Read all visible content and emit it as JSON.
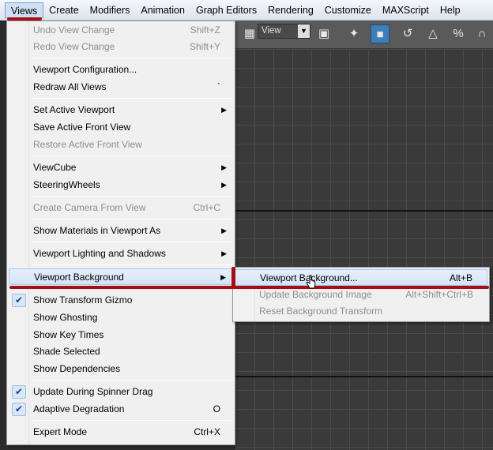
{
  "menubar": {
    "items": [
      "Views",
      "Create",
      "Modifiers",
      "Animation",
      "Graph Editors",
      "Rendering",
      "Customize",
      "MAXScript",
      "Help"
    ]
  },
  "toolbar": {
    "view_select": "View",
    "icons": [
      "viewport-split-icon",
      "walkthrough-icon",
      "box-icon",
      "snap-3d-icon",
      "angle-snap-icon",
      "percent-snap-icon",
      "spinner-snap-icon"
    ]
  },
  "views_menu": {
    "items": [
      {
        "label": "Undo View Change",
        "shortcut": "Shift+Z",
        "disabled": true
      },
      {
        "label": "Redo View Change",
        "shortcut": "Shift+Y",
        "disabled": true
      },
      {
        "label": "Viewport Configuration...",
        "shortcut": ""
      },
      {
        "label": "Redraw All Views",
        "shortcut": "`"
      },
      {
        "label": "Set Active Viewport",
        "shortcut": "",
        "submenu": true
      },
      {
        "label": "Save Active Front View",
        "shortcut": ""
      },
      {
        "label": "Restore Active Front View",
        "shortcut": "",
        "disabled": true
      },
      {
        "label": "ViewCube",
        "shortcut": "",
        "submenu": true
      },
      {
        "label": "SteeringWheels",
        "shortcut": "",
        "submenu": true
      },
      {
        "label": "Create Camera From View",
        "shortcut": "Ctrl+C",
        "disabled": true
      },
      {
        "label": "Show Materials in Viewport As",
        "shortcut": "",
        "submenu": true
      },
      {
        "label": "Viewport Lighting and Shadows",
        "shortcut": "",
        "submenu": true
      },
      {
        "label": "Viewport Background",
        "shortcut": "",
        "submenu": true,
        "highlighted": true
      },
      {
        "label": "Show Transform Gizmo",
        "shortcut": "",
        "checked": true
      },
      {
        "label": "Show Ghosting",
        "shortcut": ""
      },
      {
        "label": "Show Key Times",
        "shortcut": ""
      },
      {
        "label": "Shade Selected",
        "shortcut": ""
      },
      {
        "label": "Show Dependencies",
        "shortcut": ""
      },
      {
        "label": "Update During Spinner Drag",
        "shortcut": "",
        "checked": true
      },
      {
        "label": "Adaptive Degradation",
        "shortcut": "O",
        "checked": true
      },
      {
        "label": "Expert Mode",
        "shortcut": "Ctrl+X"
      }
    ]
  },
  "background_submenu": {
    "items": [
      {
        "label": "Viewport Background...",
        "shortcut": "Alt+B",
        "highlighted": true
      },
      {
        "label": "Update Background Image",
        "shortcut": "Alt+Shift+Ctrl+B",
        "disabled": true
      },
      {
        "label": "Reset Background Transform",
        "shortcut": "",
        "disabled": true
      }
    ]
  },
  "colors": {
    "annotation": "#a50e12",
    "highlight": "#d4e4f7",
    "viewport": "#3a3a3a"
  }
}
